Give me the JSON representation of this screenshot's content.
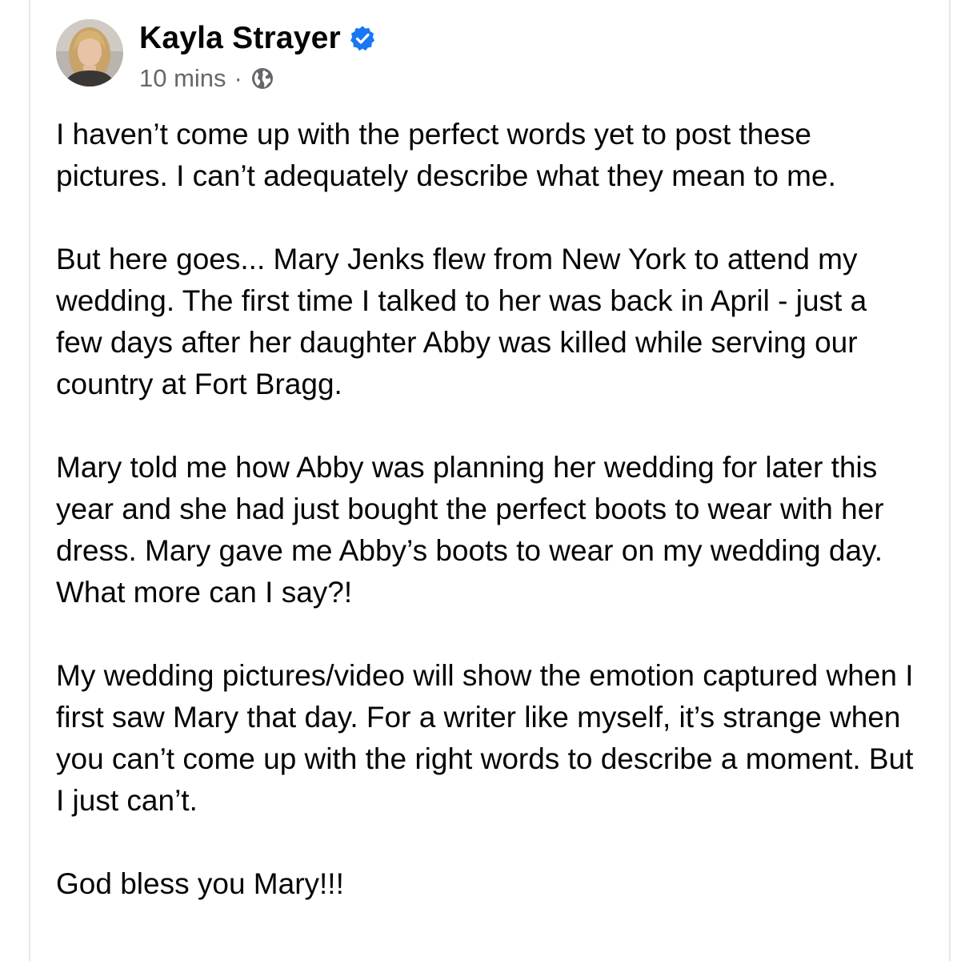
{
  "post": {
    "author": {
      "name": "Kayla Strayer",
      "verified": true,
      "verified_icon": "verified-badge-icon",
      "verified_color": "#1877f2",
      "avatar_icon": "profile-photo"
    },
    "timestamp": "10 mins",
    "separator": "·",
    "audience_icon": "globe-icon",
    "paragraphs": [
      "I haven’t come up with the perfect words yet to post these pictures. I can’t adequately describe what they mean to me.",
      "But here goes... Mary Jenks flew from New York to attend my wedding. The first time I talked to her was back in April - just a few days after her daughter Abby was killed while serving our country at Fort Bragg.",
      "Mary told me how Abby was planning her wedding for later this year and she had just bought the perfect boots to wear with her dress. Mary gave me Abby’s boots to wear on my wedding day. What more can I say?!",
      "My wedding pictures/video will show the emotion captured when I first saw Mary that day. For a writer like myself, it’s strange when you can’t come up with the right words to describe a moment. But I just can’t.",
      "God bless you Mary!!!"
    ]
  }
}
